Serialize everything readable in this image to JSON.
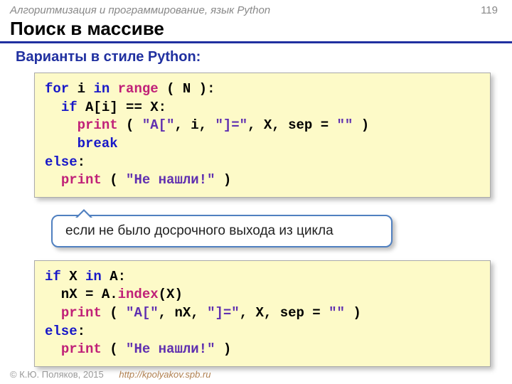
{
  "header": {
    "course": "Алгоритмизация и программирование, язык Python",
    "page": "119"
  },
  "title": "Поиск в массиве",
  "subtitle": "Варианты в стиле Python:",
  "code1": {
    "l1a": "for",
    "l1b": " i ",
    "l1c": "in",
    "l1d": " ",
    "l1e": "range",
    "l1f": " ( N ):",
    "l2a": "  ",
    "l2b": "if",
    "l2c": " A[i] == X:",
    "l3a": "    ",
    "l3b": "print",
    "l3c": " ( ",
    "l3d": "\"A[\"",
    "l3e": ", i, ",
    "l3f": "\"]=\"",
    "l3g": ", X, sep = ",
    "l3h": "\"\"",
    "l3i": " )",
    "l4a": "    ",
    "l4b": "break",
    "l5a": "else",
    "l5b": ":",
    "l6a": "  ",
    "l6b": "print",
    "l6c": " ( ",
    "l6d": "\"Не нашли!\"",
    "l6e": " )"
  },
  "callout": "если не было досрочного выхода из цикла",
  "code2": {
    "l1a": "if",
    "l1b": " X ",
    "l1c": "in",
    "l1d": " A:",
    "l2a": "  nX = A.",
    "l2b": "index",
    "l2c": "(X)",
    "l3a": "  ",
    "l3b": "print",
    "l3c": " ( ",
    "l3d": "\"A[\"",
    "l3e": ", nX, ",
    "l3f": "\"]=\"",
    "l3g": ", X, sep = ",
    "l3h": "\"\"",
    "l3i": " )",
    "l4a": "else",
    "l4b": ":",
    "l5a": "  ",
    "l5b": "print",
    "l5c": " ( ",
    "l5d": "\"Не нашли!\"",
    "l5e": " )"
  },
  "footer": {
    "copyright": "© К.Ю. Поляков, 2015",
    "url": "http://kpolyakov.spb.ru"
  }
}
